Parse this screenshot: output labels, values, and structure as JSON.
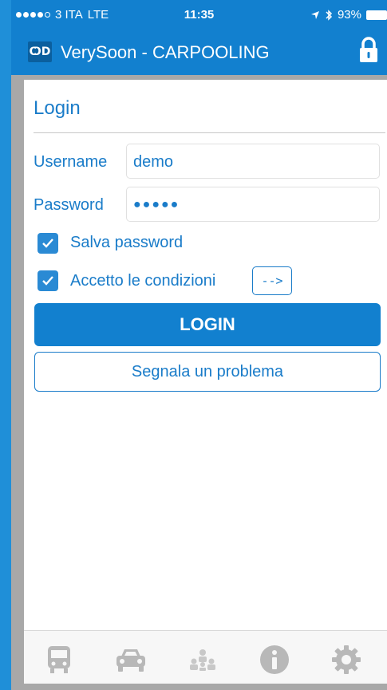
{
  "status_bar": {
    "carrier": "3 ITA",
    "network": "LTE",
    "time": "11:35",
    "battery": "93%"
  },
  "navbar": {
    "logo_text": "ѺD",
    "title": "VerySoon - CARPOOLING",
    "lock_icon": "lock-icon"
  },
  "login": {
    "title": "Login",
    "username_label": "Username",
    "username_value": "demo",
    "password_label": "Password",
    "password_value": "●●●●●",
    "save_password_label": "Salva password",
    "save_password_checked": true,
    "accept_terms_label": "Accetto le condizioni",
    "accept_terms_checked": true,
    "terms_button_label": "-->",
    "login_button_label": "LOGIN",
    "report_button_label": "Segnala un problema"
  },
  "tabbar": {
    "items": [
      {
        "icon": "bus-icon"
      },
      {
        "icon": "car-icon"
      },
      {
        "icon": "people-icon"
      },
      {
        "icon": "info-icon"
      },
      {
        "icon": "gear-icon"
      }
    ]
  },
  "colors": {
    "accent": "#1280cf",
    "text_blue": "#1a7cc9",
    "tab_icon": "#b8b8b8"
  }
}
